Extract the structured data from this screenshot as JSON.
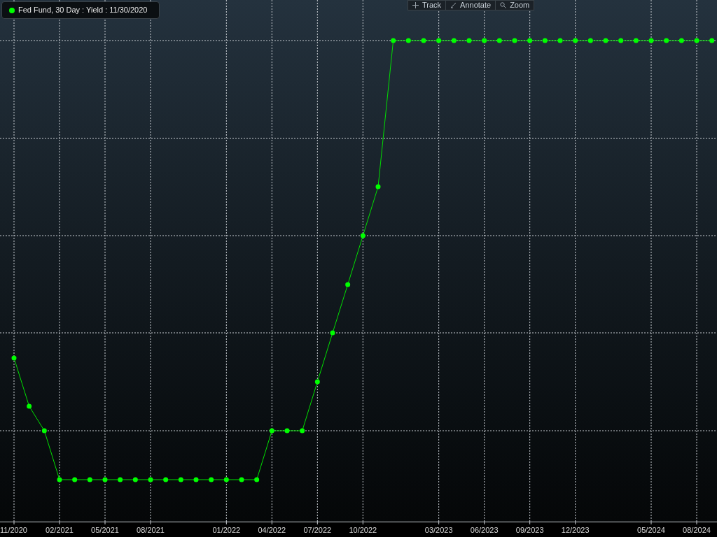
{
  "legend": {
    "label": "Fed Fund, 30 Day : Yield : 11/30/2020"
  },
  "toolbar": [
    {
      "label": "Track"
    },
    {
      "label": "Annotate"
    },
    {
      "label": "Zoom"
    }
  ],
  "x_axis": {
    "labels": [
      "11/2020",
      "02/2021",
      "05/2021",
      "08/2021",
      "01/2022",
      "04/2022",
      "07/2022",
      "10/2022",
      "03/2023",
      "06/2023",
      "09/2023",
      "12/2023",
      "05/2024",
      "08/2024"
    ]
  }
}
